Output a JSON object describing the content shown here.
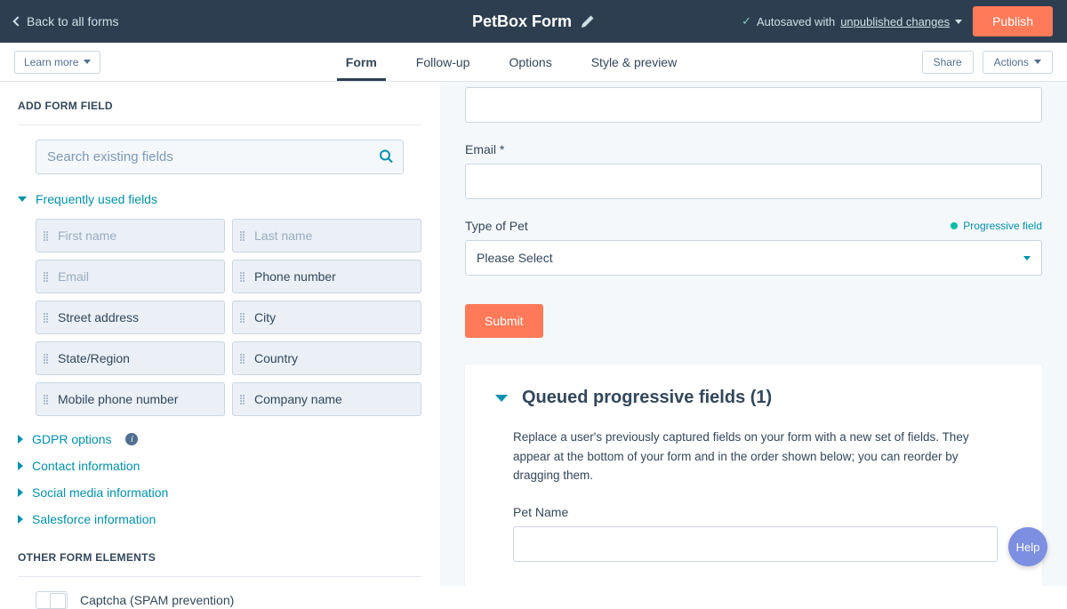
{
  "topbar": {
    "back": "Back to all forms",
    "title": "PetBox Form",
    "autosave_prefix": "Autosaved with ",
    "autosave_link": "unpublished changes",
    "publish": "Publish"
  },
  "secondbar": {
    "learn_more": "Learn more",
    "tabs": [
      "Form",
      "Follow-up",
      "Options",
      "Style & preview"
    ],
    "share": "Share",
    "actions": "Actions"
  },
  "left": {
    "add_field": "ADD FORM FIELD",
    "search_placeholder": "Search existing fields",
    "freq_used": "Frequently used fields",
    "fields": [
      {
        "label": "First name",
        "used": true
      },
      {
        "label": "Last name",
        "used": true
      },
      {
        "label": "Email",
        "used": true
      },
      {
        "label": "Phone number",
        "used": false
      },
      {
        "label": "Street address",
        "used": false
      },
      {
        "label": "City",
        "used": false
      },
      {
        "label": "State/Region",
        "used": false
      },
      {
        "label": "Country",
        "used": false
      },
      {
        "label": "Mobile phone number",
        "used": false
      },
      {
        "label": "Company name",
        "used": false
      }
    ],
    "groups": [
      "GDPR options",
      "Contact information",
      "Social media information",
      "Salesforce information"
    ],
    "other_elements": "OTHER FORM ELEMENTS",
    "captcha": "Captcha (SPAM prevention)"
  },
  "right": {
    "email_label": "Email *",
    "typeofpet_label": "Type of Pet",
    "progressive_tag": "Progressive field",
    "select_placeholder": "Please Select",
    "submit": "Submit",
    "queued_title": "Queued progressive fields (1)",
    "queued_desc": "Replace a user's previously captured fields on your form with a new set of fields. They appear at the bottom of your form and in the order shown below; you can reorder by dragging them.",
    "petname_label": "Pet Name"
  },
  "help": "Help",
  "colors": {
    "accent": "#ff7a59",
    "teal": "#0091ae",
    "navy": "#2d3e50"
  }
}
